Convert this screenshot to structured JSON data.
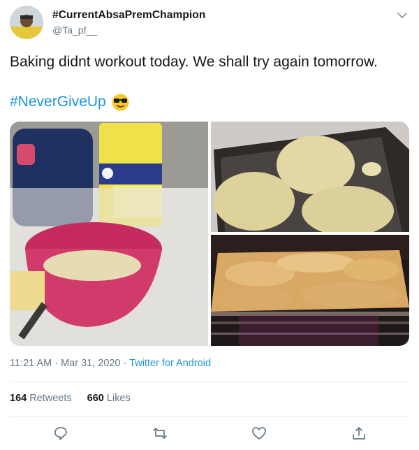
{
  "tweet": {
    "display_name": "#CurrentAbsaPremChampion",
    "handle": "@Ta_pf__",
    "text": "Baking didnt workout today. We shall try again tomorrow.",
    "hashtag": "#NeverGiveUp",
    "emoji": "smiling-face-with-sunglasses",
    "time": "11:21 AM",
    "date": "Mar 31, 2020",
    "source": "Twitter for Android",
    "separator": " · "
  },
  "stats": {
    "retweets_count": "164",
    "retweets_label": "Retweets",
    "likes_count": "660",
    "likes_label": "Likes"
  },
  "colors": {
    "link": "#1b95e0",
    "secondary_text": "#657786",
    "divider": "#e6ecf0"
  },
  "icons": {
    "more": "chevron-down-icon",
    "reply": "reply-icon",
    "retweet": "retweet-icon",
    "like": "heart-icon",
    "share": "share-icon"
  }
}
